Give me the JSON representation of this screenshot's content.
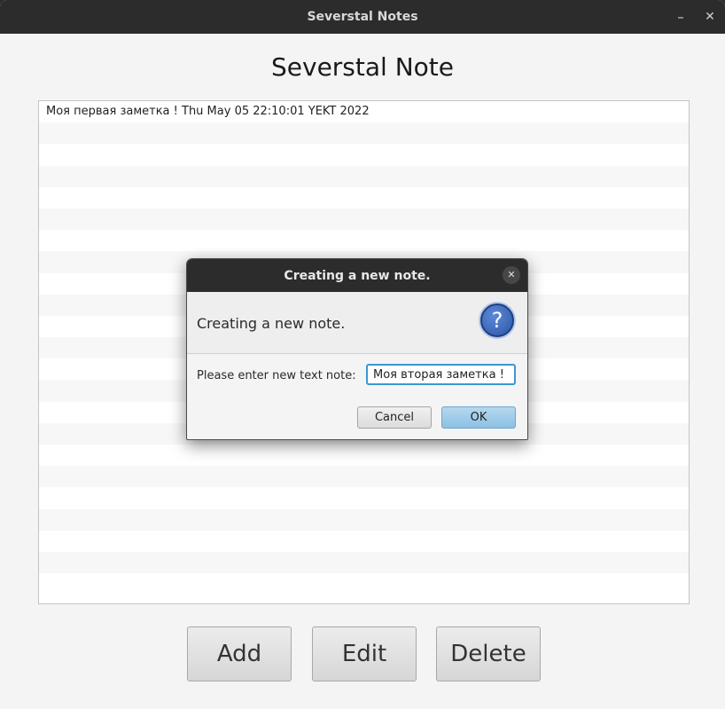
{
  "window": {
    "title": "Severstal Notes",
    "minimize_icon": "–",
    "close_icon": "✕"
  },
  "main": {
    "heading": "Severstal Note",
    "notes": [
      "Моя первая заметка !  Thu May 05 22:10:01 YEKT 2022"
    ],
    "buttons": {
      "add": "Add",
      "edit": "Edit",
      "delete": "Delete"
    }
  },
  "dialog": {
    "title": "Creating a new note.",
    "close_icon": "✕",
    "header": "Creating a new note.",
    "question_icon": "?",
    "label": "Please enter new text note:",
    "input_value": "Моя вторая заметка !",
    "cancel_label": "Cancel",
    "ok_label": "OK"
  },
  "colors": {
    "titlebar": "#2c2c2c",
    "ok_button": "#8cc1e3",
    "input_focus": "#3a97d4",
    "question_icon": "#2b56a8"
  }
}
